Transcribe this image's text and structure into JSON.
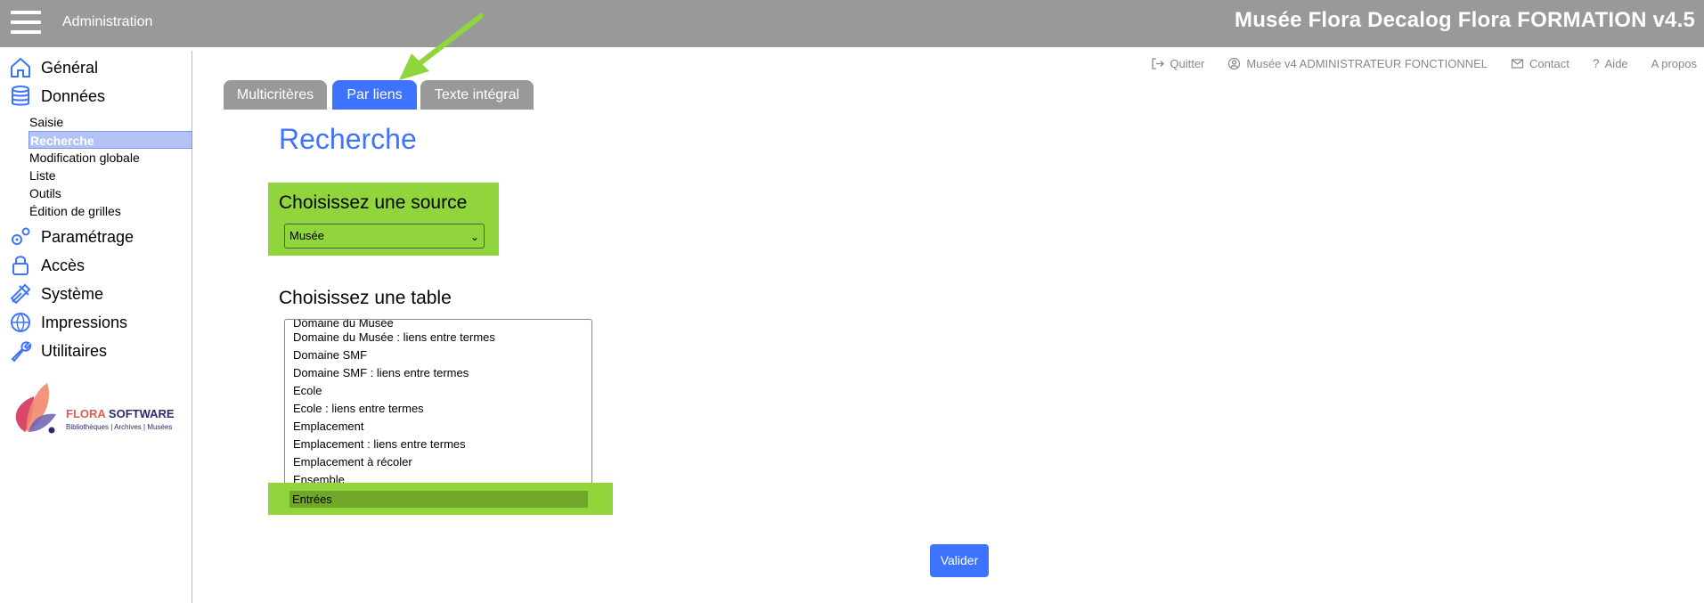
{
  "header": {
    "section": "Administration",
    "app_title": "Musée Flora Decalog Flora FORMATION v4.5"
  },
  "sidebar": {
    "items": [
      {
        "label": "Général",
        "icon": "home-icon"
      },
      {
        "label": "Données",
        "icon": "database-icon"
      },
      {
        "label": "Paramétrage",
        "icon": "gears-icon"
      },
      {
        "label": "Accès",
        "icon": "lock-icon"
      },
      {
        "label": "Système",
        "icon": "tools-icon"
      },
      {
        "label": "Impressions",
        "icon": "globe-icon"
      },
      {
        "label": "Utilitaires",
        "icon": "wrench-icon"
      }
    ],
    "sub_items": [
      "Saisie",
      "Recherche",
      "Modification globale",
      "Liste",
      "Outils",
      "Édition de grilles"
    ],
    "active_sub": "Recherche"
  },
  "logo": {
    "name_part1": "FLORA ",
    "name_part2": "SOFTWARE",
    "tagline": "Bibliothèques | Archives | Musées"
  },
  "toplinks": {
    "quit": "Quitter",
    "user": "Musée v4 ADMINISTRATEUR FONCTIONNEL",
    "contact": "Contact",
    "help": "Aide",
    "about": "A propos"
  },
  "tabs": [
    {
      "label": "Multicritères",
      "active": false
    },
    {
      "label": "Par liens",
      "active": true
    },
    {
      "label": "Texte intégral",
      "active": false
    }
  ],
  "main": {
    "title": "Recherche",
    "source_heading": "Choisissez une source",
    "source_value": "Musée",
    "table_heading": "Choisissez une table",
    "table_options": [
      "Domaine du Musée",
      "Domaine du Musée : liens entre termes",
      "Domaine SMF",
      "Domaine SMF : liens entre termes",
      "Ecole",
      "Ecole : liens entre termes",
      "Emplacement",
      "Emplacement : liens entre termes",
      "Emplacement à récoler",
      "Ensemble"
    ],
    "selected_table": "Entrées",
    "submit_label": "Valider"
  },
  "colors": {
    "accent": "#3e73ff",
    "highlight": "#8fd53b",
    "header_bg": "#999999"
  }
}
